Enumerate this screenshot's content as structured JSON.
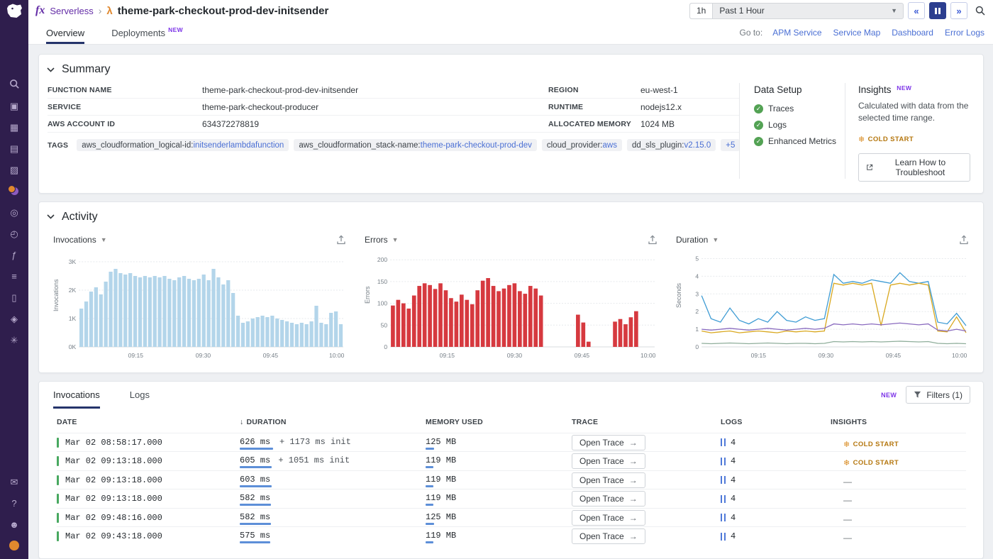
{
  "colors": {
    "brand_purple": "#632ca6",
    "link_blue": "#4a6fd4",
    "tab_underline_navy": "#25346b",
    "invocations_bar_blue": "#b3d5ea",
    "error_red": "#d6393f",
    "success_green": "#53a254",
    "cold_start_orange": "#d98a1e",
    "row_indicator_green": "#48a860"
  },
  "sidebar": {
    "top_icons": [
      {
        "name": "search-icon",
        "special": "search"
      },
      {
        "name": "infrastructure-icon",
        "glyph": "▣"
      },
      {
        "name": "dashboards-icon",
        "glyph": "▦"
      },
      {
        "name": "monitors-icon",
        "glyph": "▤"
      },
      {
        "name": "metrics-icon",
        "glyph": "▨"
      },
      {
        "name": "apm-icon",
        "special": "apm"
      },
      {
        "name": "watchdog-icon",
        "glyph": "◎"
      },
      {
        "name": "synthetics-icon",
        "glyph": "◴"
      },
      {
        "name": "serverless-icon",
        "glyph": "ƒ"
      },
      {
        "name": "pipelines-icon",
        "glyph": "≡"
      },
      {
        "name": "notebooks-icon",
        "glyph": "▯"
      },
      {
        "name": "security-icon",
        "glyph": "◈"
      },
      {
        "name": "settings-icon",
        "glyph": "✳"
      }
    ],
    "bottom_icons": [
      {
        "name": "chat-icon",
        "glyph": "✉"
      },
      {
        "name": "help-icon",
        "glyph": "?"
      },
      {
        "name": "users-icon",
        "glyph": "☻"
      },
      {
        "name": "bits-pug-icon",
        "special": "pug"
      }
    ]
  },
  "header": {
    "product_icon": "fx",
    "product": "Serverless",
    "breadcrumb_separator": "›",
    "lambda_icon": "λ",
    "title": "theme-park-checkout-prod-dev-initsender",
    "time_short": "1h",
    "time_label": "Past 1 Hour"
  },
  "tabbar": {
    "tabs": [
      {
        "label": "Overview",
        "active": true
      },
      {
        "label": "Deployments",
        "active": false,
        "badge": "NEW"
      }
    ],
    "goto_label": "Go to:",
    "links": [
      "APM Service",
      "Service Map",
      "Dashboard",
      "Error Logs"
    ]
  },
  "summary": {
    "title": "Summary",
    "rows": [
      {
        "label1": "FUNCTION NAME",
        "value1": "theme-park-checkout-prod-dev-initsender",
        "label2": "REGION",
        "value2": "eu-west-1"
      },
      {
        "label1": "SERVICE",
        "value1": "theme-park-checkout-producer",
        "label2": "RUNTIME",
        "value2": "nodejs12.x"
      },
      {
        "label1": "AWS ACCOUNT ID",
        "value1": "634372278819",
        "label2": "ALLOCATED MEMORY",
        "value2": "1024 MB"
      }
    ],
    "tags_label": "TAGS",
    "tags": [
      {
        "key": "aws_cloudformation_logical-id:",
        "value": "initsenderlambdafunction"
      },
      {
        "key": "aws_cloudformation_stack-name:",
        "value": "theme-park-checkout-prod-dev"
      },
      {
        "key": "cloud_provider:",
        "value": "aws"
      },
      {
        "key": "dd_sls_plugin:",
        "value": "v2.15.0"
      }
    ],
    "tags_more": "+5",
    "data_setup": {
      "title": "Data Setup",
      "items": [
        "Traces",
        "Logs",
        "Enhanced Metrics"
      ]
    },
    "insights": {
      "title": "Insights",
      "badge": "NEW",
      "description": "Calculated with data from the selected time range.",
      "cold_start_label": "COLD START",
      "button_label": "Learn How to Troubleshoot"
    }
  },
  "activity": {
    "title": "Activity"
  },
  "chart_data": [
    {
      "type": "bar",
      "title": "Invocations",
      "ylabel": "Invocations",
      "color": "#b3d5ea",
      "ymax": 3300,
      "ytick_vals": [
        0,
        1000,
        2000,
        3000
      ],
      "yticks": [
        "0K",
        "1K",
        "2K",
        "3K"
      ],
      "xticks": [
        "09:15",
        "09:30",
        "09:45",
        "10:00"
      ],
      "values": [
        1350,
        1600,
        1950,
        2100,
        1850,
        2300,
        2650,
        2750,
        2600,
        2550,
        2600,
        2500,
        2450,
        2500,
        2450,
        2500,
        2450,
        2500,
        2400,
        2350,
        2450,
        2500,
        2400,
        2350,
        2400,
        2550,
        2350,
        2750,
        2450,
        2200,
        2350,
        1900,
        1100,
        850,
        900,
        1000,
        1050,
        1100,
        1050,
        1100,
        1000,
        950,
        900,
        850,
        800,
        850,
        800,
        900,
        1450,
        850,
        800,
        1200,
        1250,
        800
      ]
    },
    {
      "type": "bar",
      "title": "Errors",
      "ylabel": "Errors",
      "color": "#d6393f",
      "ymax": 215,
      "ytick_vals": [
        0,
        50,
        100,
        150,
        200
      ],
      "yticks": [
        "0",
        "50",
        "100",
        "150",
        "200"
      ],
      "xticks": [
        "09:15",
        "09:30",
        "09:45",
        "10:00"
      ],
      "values": [
        95,
        108,
        100,
        88,
        118,
        140,
        146,
        142,
        133,
        146,
        130,
        112,
        104,
        120,
        108,
        98,
        130,
        152,
        158,
        140,
        128,
        134,
        142,
        146,
        128,
        122,
        140,
        134,
        118,
        0,
        0,
        0,
        0,
        0,
        0,
        74,
        56,
        12,
        0,
        0,
        0,
        0,
        58,
        64,
        52,
        68,
        82,
        0,
        0,
        0
      ]
    },
    {
      "type": "line",
      "title": "Duration",
      "ylabel": "Seconds",
      "ymax": 5.3,
      "ytick_vals": [
        0,
        1,
        2,
        3,
        4,
        5
      ],
      "yticks": [
        "0",
        "1",
        "2",
        "3",
        "4",
        "5"
      ],
      "xticks": [
        "09:15",
        "09:30",
        "09:45",
        "10:00"
      ],
      "series": [
        {
          "name": "duration-max-blue",
          "color": "#3f9cd4",
          "values": [
            2.9,
            1.6,
            1.4,
            2.2,
            1.5,
            1.3,
            1.6,
            1.4,
            2.0,
            1.5,
            1.4,
            1.7,
            1.5,
            1.6,
            4.1,
            3.6,
            3.7,
            3.6,
            3.8,
            3.7,
            3.6,
            4.2,
            3.7,
            3.6,
            3.7,
            1.4,
            1.3,
            1.9,
            1.2
          ]
        },
        {
          "name": "duration-p99-yellow",
          "color": "#d9a81f",
          "values": [
            0.9,
            0.8,
            0.85,
            0.9,
            0.8,
            0.85,
            0.9,
            0.85,
            0.8,
            0.9,
            0.85,
            0.9,
            0.85,
            0.9,
            3.6,
            3.5,
            3.6,
            3.5,
            3.6,
            1.2,
            3.5,
            3.6,
            3.5,
            3.6,
            3.5,
            0.9,
            0.85,
            1.7,
            0.8
          ]
        },
        {
          "name": "duration-avg-purple",
          "color": "#8a6bbf",
          "values": [
            1.0,
            0.95,
            1.0,
            1.05,
            1.0,
            0.95,
            1.0,
            1.05,
            1.0,
            0.95,
            1.0,
            1.05,
            1.0,
            1.05,
            1.3,
            1.25,
            1.3,
            1.25,
            1.3,
            1.25,
            1.3,
            1.35,
            1.3,
            1.25,
            1.3,
            0.95,
            0.9,
            1.0,
            0.9
          ]
        },
        {
          "name": "duration-min-gray",
          "color": "#8fae9b",
          "values": [
            0.2,
            0.18,
            0.2,
            0.22,
            0.2,
            0.18,
            0.2,
            0.22,
            0.2,
            0.18,
            0.2,
            0.2,
            0.18,
            0.2,
            0.3,
            0.28,
            0.3,
            0.28,
            0.3,
            0.28,
            0.3,
            0.32,
            0.3,
            0.28,
            0.3,
            0.2,
            0.18,
            0.2,
            0.18
          ]
        }
      ]
    }
  ],
  "invocations_panel": {
    "tabs": [
      {
        "label": "Invocations",
        "active": true
      },
      {
        "label": "Logs",
        "active": false
      }
    ],
    "new_badge": "NEW",
    "filters_label": "Filters (1)",
    "columns": [
      "DATE",
      "DURATION",
      "MEMORY USED",
      "TRACE",
      "LOGS",
      "INSIGHTS"
    ],
    "sort_arrow": "↓",
    "open_trace_label": "Open Trace",
    "cold_start_label": "COLD START",
    "no_insight": "—",
    "rows": [
      {
        "date": "Mar 02 08:58:17.000",
        "duration": "626 ms",
        "duration_ms": 626,
        "init": "+ 1173 ms init",
        "memory": "125 MB",
        "memory_mb": 125,
        "logs": "4",
        "cold_start": true
      },
      {
        "date": "Mar 02 09:13:18.000",
        "duration": "605 ms",
        "duration_ms": 605,
        "init": "+ 1051 ms init",
        "memory": "119 MB",
        "memory_mb": 119,
        "logs": "4",
        "cold_start": true
      },
      {
        "date": "Mar 02 09:13:18.000",
        "duration": "603 ms",
        "duration_ms": 603,
        "init": "",
        "memory": "119 MB",
        "memory_mb": 119,
        "logs": "4",
        "cold_start": false
      },
      {
        "date": "Mar 02 09:13:18.000",
        "duration": "582 ms",
        "duration_ms": 582,
        "init": "",
        "memory": "119 MB",
        "memory_mb": 119,
        "logs": "4",
        "cold_start": false
      },
      {
        "date": "Mar 02 09:48:16.000",
        "duration": "582 ms",
        "duration_ms": 582,
        "init": "",
        "memory": "125 MB",
        "memory_mb": 125,
        "logs": "4",
        "cold_start": false
      },
      {
        "date": "Mar 02 09:43:18.000",
        "duration": "575 ms",
        "duration_ms": 575,
        "init": "",
        "memory": "119 MB",
        "memory_mb": 119,
        "logs": "4",
        "cold_start": false
      }
    ]
  }
}
